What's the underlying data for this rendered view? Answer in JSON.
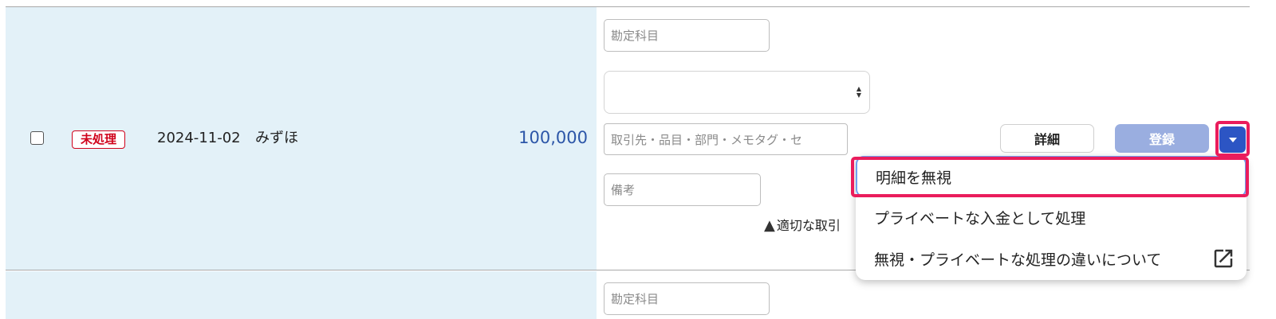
{
  "row1": {
    "status": "未処理",
    "date": "2024-11-02",
    "bank": "みずほ",
    "amount": "100,000",
    "account_placeholder": "勘定科目",
    "partner_placeholder": "取引先・品目・部門・メモタグ・セ",
    "memo_placeholder": "備考",
    "warning_text": "適切な取引",
    "detail_label": "詳細",
    "register_label": "登録"
  },
  "row2": {
    "account_placeholder": "勘定科目"
  },
  "menu": {
    "items": [
      {
        "label": "明細を無視"
      },
      {
        "label": "プライベートな入金として処理"
      },
      {
        "label": "無視・プライベートな処理の違いについて"
      }
    ]
  },
  "icons": {
    "checkbox": "checkbox-icon",
    "select": "select-arrows-icon",
    "warning": "warning-icon",
    "dropdown": "caret-down-icon",
    "external": "external-link-icon"
  },
  "colors": {
    "row_bg": "#e3f1f8",
    "status_red": "#d0021b",
    "amount_blue": "#2c56a8",
    "register_blue": "#9aaee0",
    "dropdown_blue": "#2c55c4",
    "highlight": "#ea1c5c"
  }
}
